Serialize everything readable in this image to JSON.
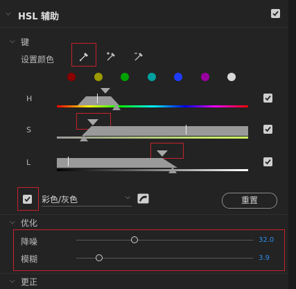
{
  "header": {
    "title": "HSL 辅助"
  },
  "sections": {
    "key": "键",
    "refine": "优化",
    "correction": "更正"
  },
  "set_color": {
    "label": "设置颜色"
  },
  "swatches": [
    {
      "name": "red",
      "color": "#8b0000"
    },
    {
      "name": "yellow",
      "color": "#9a9a00"
    },
    {
      "name": "green",
      "color": "#00a000"
    },
    {
      "name": "cyan",
      "color": "#00a0a0"
    },
    {
      "name": "blue",
      "color": "#1e3cff"
    },
    {
      "name": "magenta",
      "color": "#9a00a0"
    },
    {
      "name": "white",
      "color": "#d8d8d8"
    }
  ],
  "channels": {
    "h": "H",
    "s": "S",
    "l": "L"
  },
  "controls": {
    "mode_dropdown": "彩色/灰色",
    "reset_button": "重置"
  },
  "refine": {
    "denoise": {
      "label": "降噪",
      "value": "32.0",
      "fraction": 0.33
    },
    "blur": {
      "label": "模糊",
      "value": "3.9",
      "fraction": 0.13
    }
  },
  "colors": {
    "accent_value": "#2d8ceb",
    "highlight_box": "#c8232c"
  }
}
